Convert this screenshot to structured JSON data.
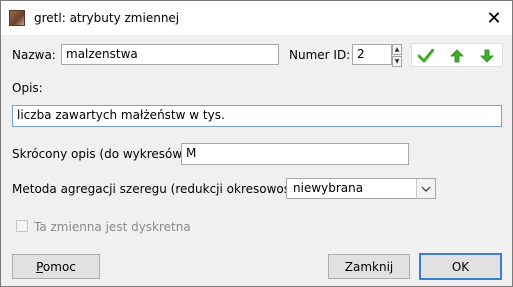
{
  "window": {
    "title": "gretl: atrybuty zmiennej",
    "app_icon": "gretl-app-icon",
    "close_icon": "close-icon"
  },
  "fields": {
    "name_label": "Nazwa:",
    "name_value": "malzenstwa",
    "id_label": "Numer ID:",
    "id_value": "2",
    "desc_label": "Opis:",
    "desc_value": "liczba zawartych małżeństw w tys.",
    "short_label": "Skrócony opis (do wykresów):",
    "short_value": "M",
    "agg_label": "Metoda agregacji szeregu (redukcji okresowości):",
    "agg_value": "niewybrana",
    "discrete_label": "Ta zmienna jest dyskretna"
  },
  "toolbar": {
    "apply_icon": "checkmark-icon",
    "up_icon": "arrow-up-icon",
    "down_icon": "arrow-down-icon",
    "icon_color": "#3cae28"
  },
  "buttons": {
    "help": "Pomoc",
    "close": "Zamknij",
    "ok": "OK"
  }
}
